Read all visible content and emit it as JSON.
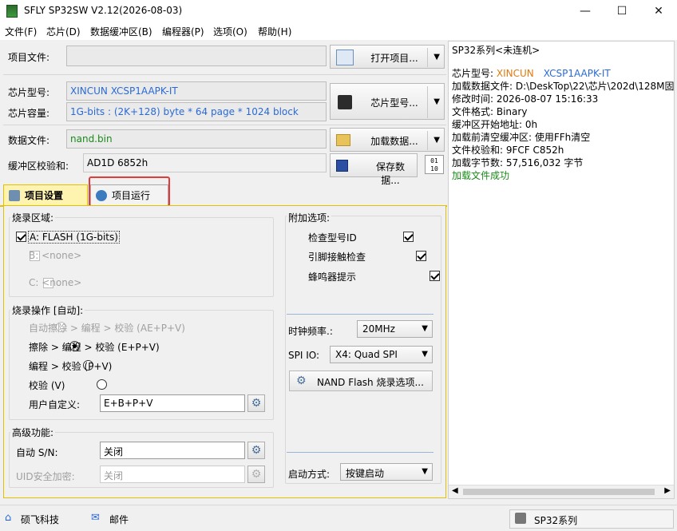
{
  "window": {
    "title": "SFLY SP32SW V2.12(2026-08-03)",
    "minimize": "—",
    "maximize": "☐",
    "close": "✕"
  },
  "menu": [
    "文件(F)",
    "芯片(D)",
    "数据缓冲区(B)",
    "编程器(P)",
    "选项(O)",
    "帮助(H)"
  ],
  "project": {
    "label": "项目文件:",
    "value": "",
    "open_button": "打开项目..."
  },
  "chip": {
    "model_label": "芯片型号:",
    "model_value": "XINCUN XCSP1AAPK-IT",
    "capacity_label": "芯片容量:",
    "capacity_value": "1G-bits : (2K+128) byte * 64 page * 1024 block",
    "button": "芯片型号..."
  },
  "data": {
    "file_label": "数据文件:",
    "file_value": "nand.bin",
    "load_button": "加载数据...",
    "checksum_label": "缓冲区校验和:",
    "checksum_value": "AD1D 6852h",
    "save_button": "保存数据...",
    "hex_icon_text": "01 10"
  },
  "tabs": {
    "settings": "项目设置",
    "run": "项目运行"
  },
  "burn_area": {
    "title": "烧录区域:",
    "a": "A: FLASH (1G-bits)",
    "b": "B: <none>",
    "c": "C: <none>"
  },
  "burn_op": {
    "title": "烧录操作 [自动]:",
    "opt1": "自动擦除 > 编程 > 校验 (AE+P+V)",
    "opt2": "擦除 > 编程 > 校验 (E+P+V)",
    "opt3": "编程 > 校验 (P+V)",
    "opt4": "校验 (V)",
    "opt5": "用户自定义:",
    "custom_value": "E+B+P+V"
  },
  "advanced": {
    "title": "高级功能:",
    "auto_sn_label": "自动 S/N:",
    "auto_sn_value": "关闭",
    "uid_label": "UID安全加密:",
    "uid_value": "关闭"
  },
  "extra": {
    "title": "附加选项:",
    "check_id": "检查型号ID",
    "pin_check": "引脚接触检查",
    "buzzer": "蜂鸣器提示",
    "clock_label": "时钟频率.:",
    "clock_value": "20MHz",
    "spi_label": "SPI IO:",
    "spi_value": "X4: Quad SPI",
    "nand_button": "NAND Flash 烧录选项...",
    "start_label": "启动方式:",
    "start_value": "按键启动"
  },
  "log": {
    "header": "SP32系列<未连机>",
    "chip_label": "芯片型号: ",
    "chip_vendor": "XINCUN",
    "chip_model": "XCSP1AAPK-IT",
    "lines": [
      "加载数据文件: D:\\DeskTop\\22\\芯片\\202d\\128M固",
      "修改时间: 2026-08-07 15:16:33",
      "文件格式: Binary",
      "缓冲区开始地址: 0h",
      "加载前清空缓冲区: 使用FFh清空",
      "文件校验和: 9FCF C852h",
      "加载字节数: 57,516,032 字节"
    ],
    "success": "加载文件成功"
  },
  "status": {
    "company": "硕飞科技",
    "mail": "邮件",
    "series": "SP32系列"
  },
  "colors": {
    "link_blue": "#2a6ad6",
    "value_green": "#1a8a1a",
    "vendor_orange": "#e07a10",
    "tab_highlight": "#e23b3b",
    "panel_border": "#e3c100"
  }
}
